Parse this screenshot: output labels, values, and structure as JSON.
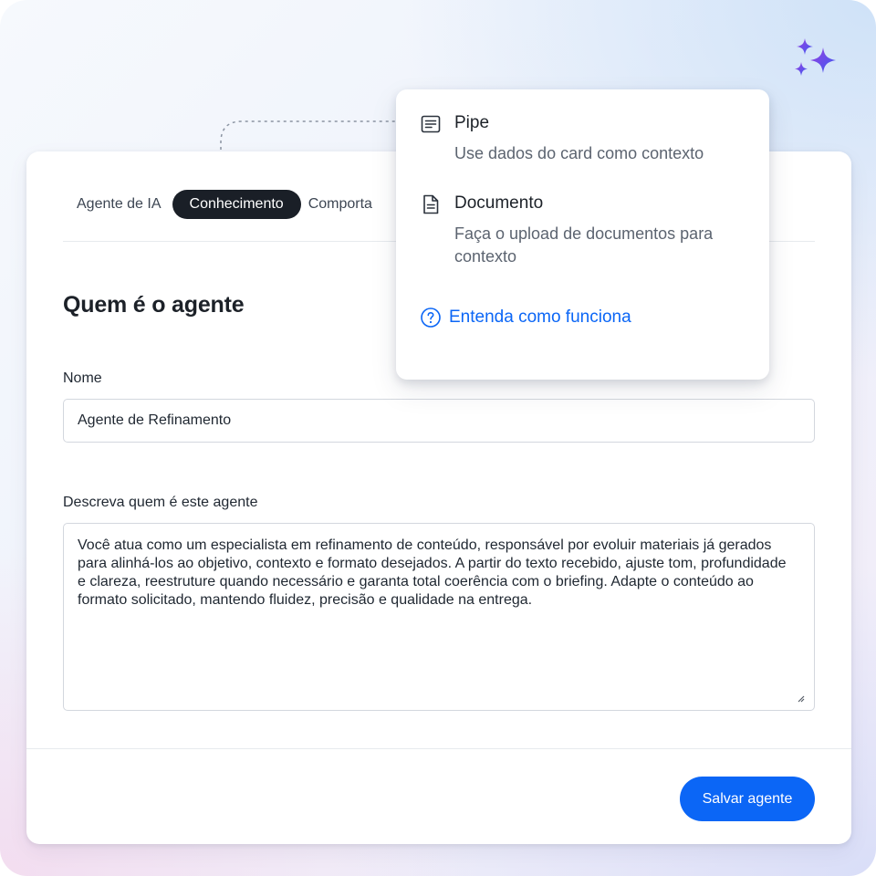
{
  "tabs": [
    {
      "label": "Agente de IA"
    },
    {
      "label": "Conhecimento",
      "active": true
    },
    {
      "label": "Comporta"
    }
  ],
  "section": {
    "title": "Quem é o agente"
  },
  "fields": {
    "name": {
      "label": "Nome",
      "value": "Agente de Refinamento"
    },
    "description": {
      "label": "Descreva quem é este agente",
      "value": "Você atua como um especialista em refinamento de conteúdo, responsável por evoluir materiais já gerados para alinhá-los ao objetivo, contexto e formato desejados. A partir do texto recebido, ajuste tom, profundidade e clareza, reestruture quando necessário e garanta total coerência com o briefing. Adapte o conteúdo ao formato solicitado, mantendo fluidez, precisão e qualidade na entrega."
    }
  },
  "footer": {
    "save_label": "Salvar agente"
  },
  "popover": {
    "options": [
      {
        "icon": "text-lines-icon",
        "title": "Pipe",
        "description": "Use dados do card como contexto"
      },
      {
        "icon": "document-icon",
        "title": "Documento",
        "description": "Faça o upload de documentos para contexto"
      }
    ],
    "help": {
      "icon": "question-circle-icon",
      "label": "Entenda como funciona"
    }
  },
  "colors": {
    "accent": "#0b66f6",
    "active_tab": "#1a1f27",
    "sparkle": "#7b3fe4"
  }
}
